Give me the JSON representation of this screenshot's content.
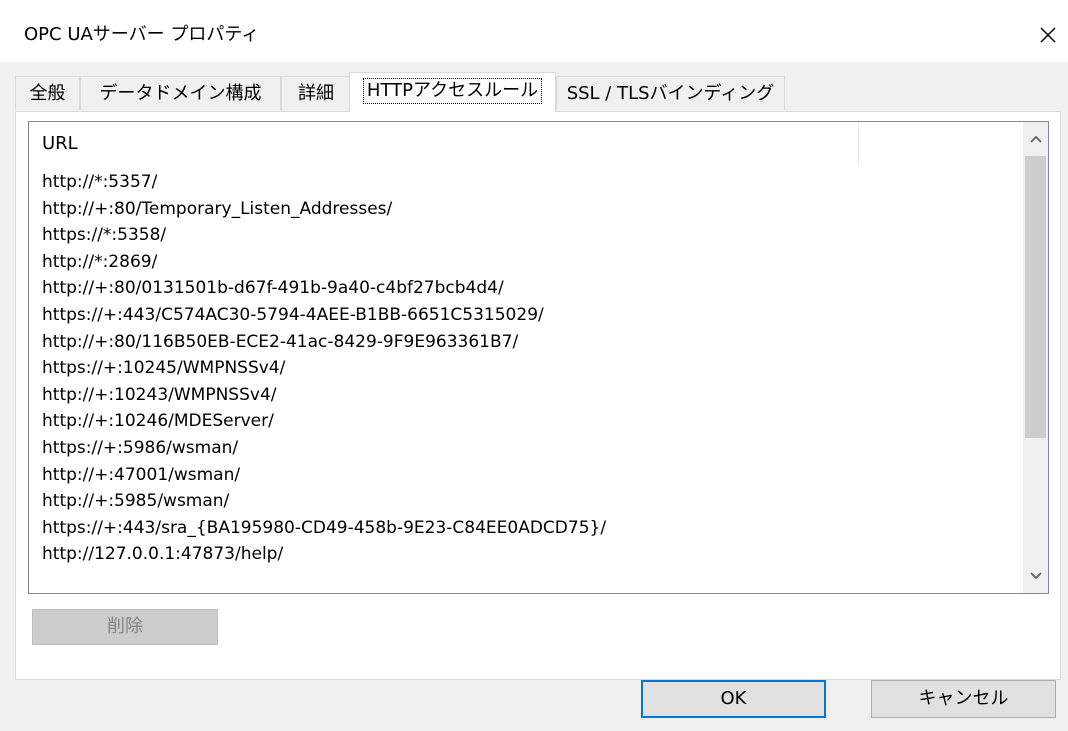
{
  "window": {
    "title": "OPC UAサーバー プロパティ",
    "close_icon": "close-icon"
  },
  "tabs": [
    {
      "label": "全般",
      "active": false
    },
    {
      "label": "データドメイン構成",
      "active": false
    },
    {
      "label": "詳細",
      "active": false
    },
    {
      "label": "HTTPアクセスルール",
      "active": true
    },
    {
      "label": "SSL / TLSバインディング",
      "active": false
    }
  ],
  "list": {
    "column_header": "URL",
    "rows": [
      "http://*:5357/",
      "http://+:80/Temporary_Listen_Addresses/",
      "https://*:5358/",
      "http://*:2869/",
      "http://+:80/0131501b-d67f-491b-9a40-c4bf27bcb4d4/",
      "https://+:443/C574AC30-5794-4AEE-B1BB-6651C5315029/",
      "http://+:80/116B50EB-ECE2-41ac-8429-9F9E963361B7/",
      "https://+:10245/WMPNSSv4/",
      "http://+:10243/WMPNSSv4/",
      "http://+:10246/MDEServer/",
      "https://+:5986/wsman/",
      "http://+:47001/wsman/",
      "http://+:5985/wsman/",
      "https://+:443/sra_{BA195980-CD49-458b-9E23-C84EE0ADCD75}/",
      "http://127.0.0.1:47873/help/"
    ],
    "scroll_up_icon": "chevron-up-icon",
    "scroll_down_icon": "chevron-down-icon"
  },
  "buttons": {
    "delete": "削除",
    "ok": "OK",
    "cancel": "キャンセル"
  }
}
